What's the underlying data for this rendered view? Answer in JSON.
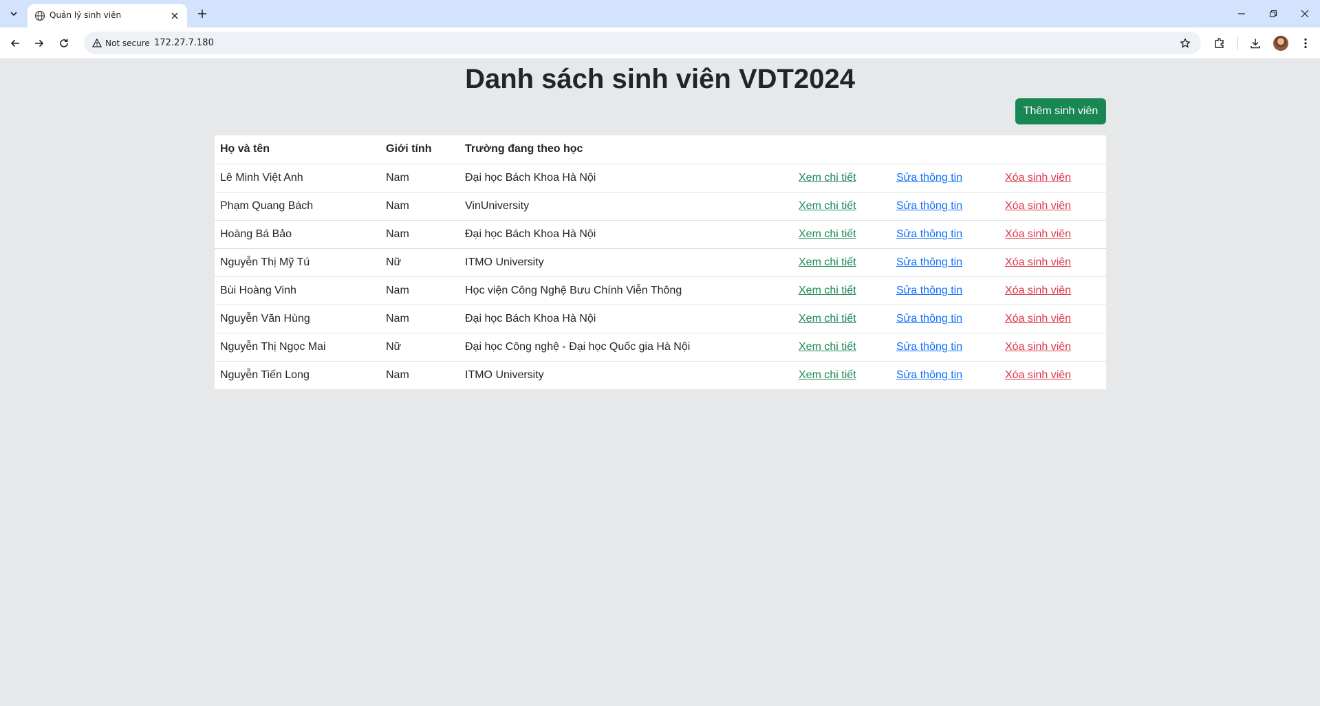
{
  "browser": {
    "tab_title": "Quản lý sinh viên",
    "security_label": "Not secure",
    "url": "172.27.7.180"
  },
  "page": {
    "title": "Danh sách sinh viên VDT2024",
    "add_button": "Thêm sinh viên"
  },
  "table": {
    "headers": {
      "name": "Họ và tên",
      "gender": "Giới tính",
      "school": "Trường đang theo học"
    },
    "actions": {
      "view": "Xem chi tiết",
      "edit": "Sửa thông tin",
      "delete": "Xóa sinh viên"
    },
    "rows": [
      {
        "name": "Lê Minh Việt Anh",
        "gender": "Nam",
        "school": "Đại học Bách Khoa Hà Nội"
      },
      {
        "name": "Phạm Quang Bách",
        "gender": "Nam",
        "school": "VinUniversity"
      },
      {
        "name": "Hoàng Bá Bảo",
        "gender": "Nam",
        "school": "Đại học Bách Khoa Hà Nội"
      },
      {
        "name": "Nguyễn Thị Mỹ Tú",
        "gender": "Nữ",
        "school": "ITMO University"
      },
      {
        "name": "Bùi Hoàng Vinh",
        "gender": "Nam",
        "school": "Học viện Công Nghệ Bưu Chính Viễn Thông"
      },
      {
        "name": "Nguyễn Văn Hùng",
        "gender": "Nam",
        "school": "Đại học Bách Khoa Hà Nội"
      },
      {
        "name": "Nguyễn Thị Ngọc Mai",
        "gender": "Nữ",
        "school": "Đại học Công nghệ - Đại học Quốc gia Hà Nội"
      },
      {
        "name": "Nguyễn Tiến Long",
        "gender": "Nam",
        "school": "ITMO University"
      }
    ]
  },
  "colors": {
    "page_background": "#e7e8e9",
    "success": "#198754",
    "primary": "#0d6efd",
    "danger": "#dc3545"
  }
}
